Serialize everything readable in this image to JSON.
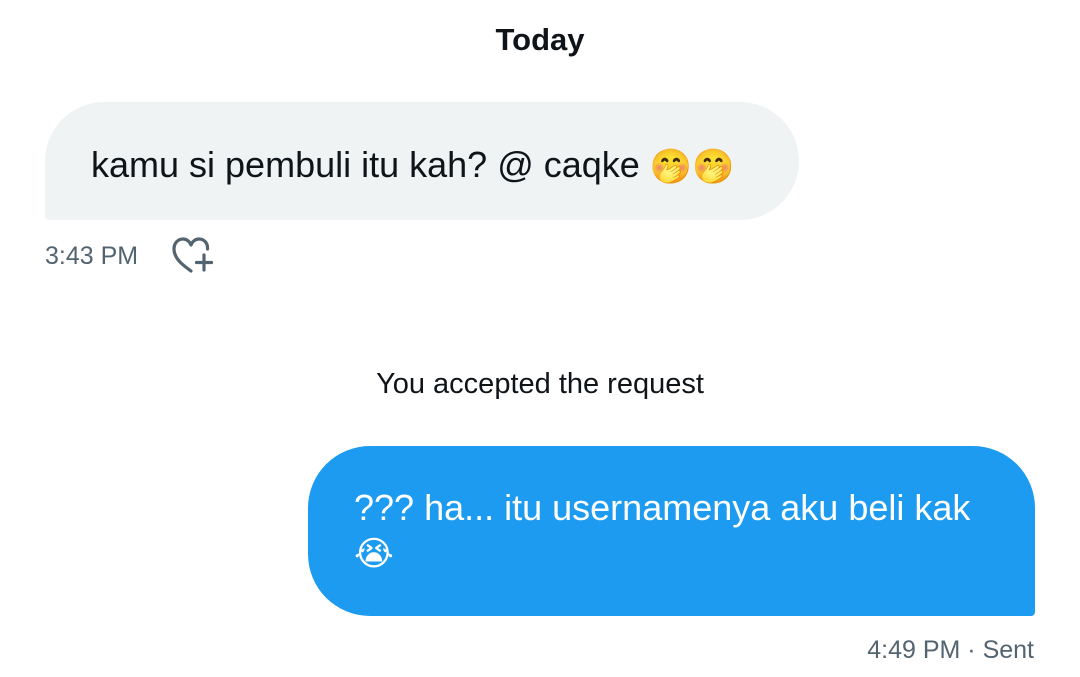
{
  "conversation": {
    "date_header": "Today",
    "received_message": {
      "text": "kamu si pembuli itu kah? @ caqke ",
      "emoji": "🤭🤭",
      "emoji_name": "face-with-hand-over-mouth",
      "time": "3:43 PM"
    },
    "system_notice": "You accepted the request",
    "sent_message": {
      "text": "??? ha... itu usernamenya aku beli kak",
      "emoji": "😭",
      "emoji_name": "loudly-crying-face",
      "time": "4:49 PM",
      "separator": " · ",
      "status": "Sent"
    }
  },
  "colors": {
    "received_bubble": "#eff3f4",
    "sent_bubble": "#1d9bf0",
    "secondary_text": "#536471",
    "primary_text": "#0f1419"
  },
  "icons": {
    "react": "heart-plus-icon"
  }
}
